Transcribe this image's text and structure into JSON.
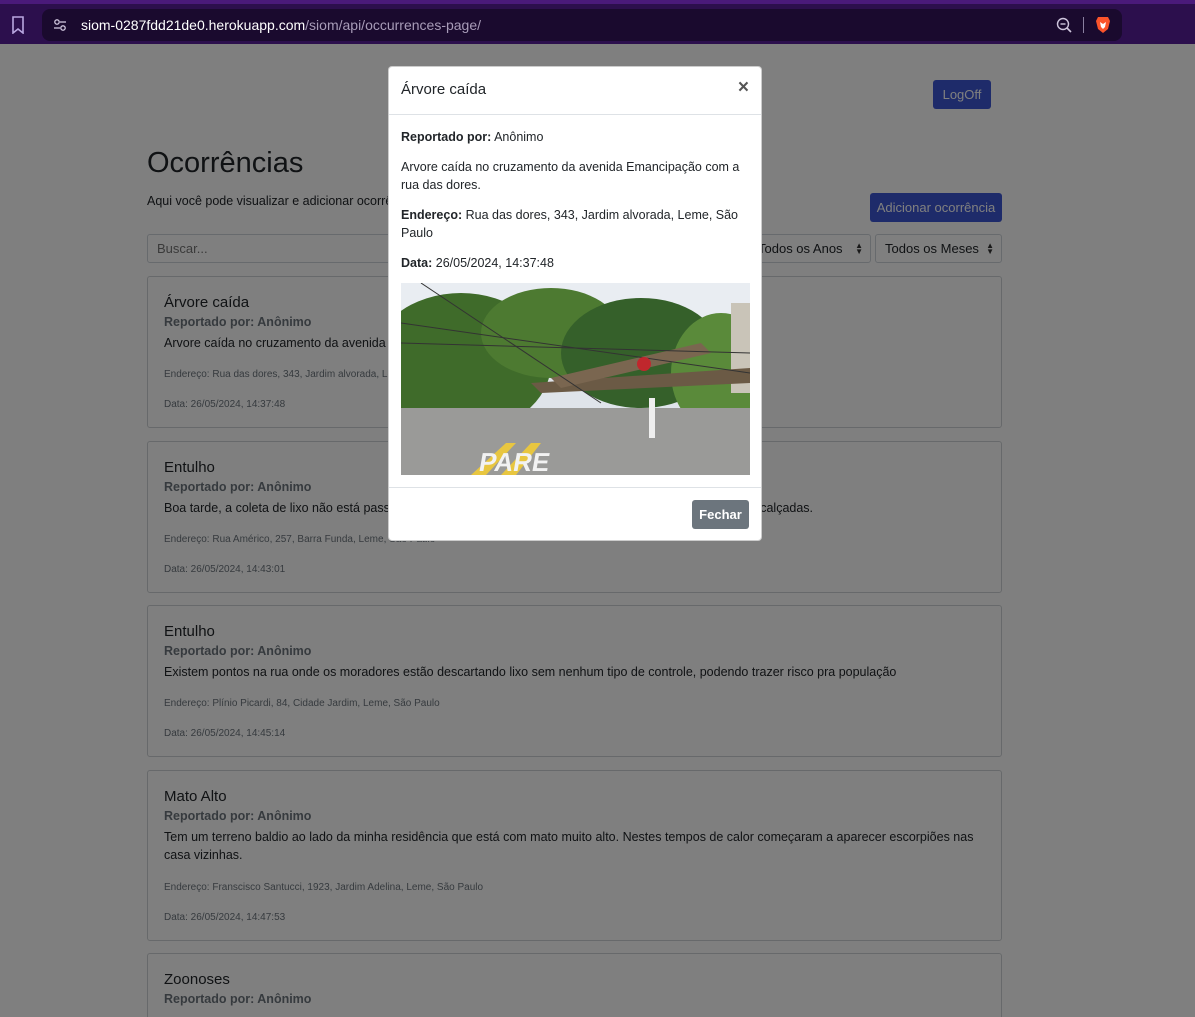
{
  "browser": {
    "url_host": "siom-0287fdd21de0.herokuapp.com",
    "url_path": "/siom/api/occurrences-page/"
  },
  "header": {
    "logoff_label": "LogOff"
  },
  "page": {
    "title": "Ocorrências",
    "subtitle": "Aqui você pode visualizar e adicionar ocorrências.",
    "add_button": "Adicionar ocorrência",
    "search_placeholder": "Buscar...",
    "year_filter": "Todos os Anos",
    "month_filter": "Todos os Meses"
  },
  "occurrences": [
    {
      "title": "Árvore caída",
      "reporter": "Reportado por: Anônimo",
      "description": "Arvore caída no cruzamento da avenida Emancipação com a rua das dores.",
      "address": "Endereço: Rua das dores, 343, Jardim alvorada, Leme, São Paulo",
      "date": "Data: 26/05/2024, 14:37:48"
    },
    {
      "title": "Entulho",
      "reporter": "Reportado por: Anônimo",
      "description": "Boa tarde, a coleta de lixo não está passando na minha rua há vários dias e o lixo está se acumulando nas calçadas.",
      "address": "Endereço: Rua Américo, 257, Barra Funda, Leme, São Paulo",
      "date": "Data: 26/05/2024, 14:43:01"
    },
    {
      "title": "Entulho",
      "reporter": "Reportado por: Anônimo",
      "description": "Existem pontos na rua onde os moradores estão descartando lixo sem nenhum tipo de controle, podendo trazer risco pra população",
      "address": "Endereço: Plínio Picardi, 84, Cidade Jardim, Leme, São Paulo",
      "date": "Data: 26/05/2024, 14:45:14"
    },
    {
      "title": "Mato Alto",
      "reporter": "Reportado por: Anônimo",
      "description": "Tem um terreno baldio ao lado da minha residência que está com mato muito alto. Nestes tempos de calor começaram a aparecer escorpiões nas casa vizinhas.",
      "address": "Endereço: Franscisco Santucci, 1923, Jardim Adelina, Leme, São Paulo",
      "date": "Data: 26/05/2024, 14:47:53"
    },
    {
      "title": "Zoonoses",
      "reporter": "Reportado por: Anônimo",
      "description": "",
      "address": "",
      "date": ""
    }
  ],
  "modal": {
    "title": "Árvore caída",
    "reporter_label": "Reportado por:",
    "reporter_value": "Anônimo",
    "description": "Arvore caída no cruzamento da avenida Emancipação com a rua das dores.",
    "address_label": "Endereço:",
    "address_value": "Rua das dores, 343, Jardim alvorada, Leme, São Paulo",
    "date_label": "Data:",
    "date_value": "26/05/2024, 14:37:48",
    "close_symbol": "×",
    "close_button": "Fechar"
  },
  "colors": {
    "primary": "#3d56d4",
    "secondary": "#6c757d",
    "browser_bar": "#2c0f4d"
  },
  "icons": [
    "bookmark-icon",
    "tune-icon",
    "zoom-icon",
    "brave-icon",
    "caret-icon",
    "close-icon"
  ]
}
